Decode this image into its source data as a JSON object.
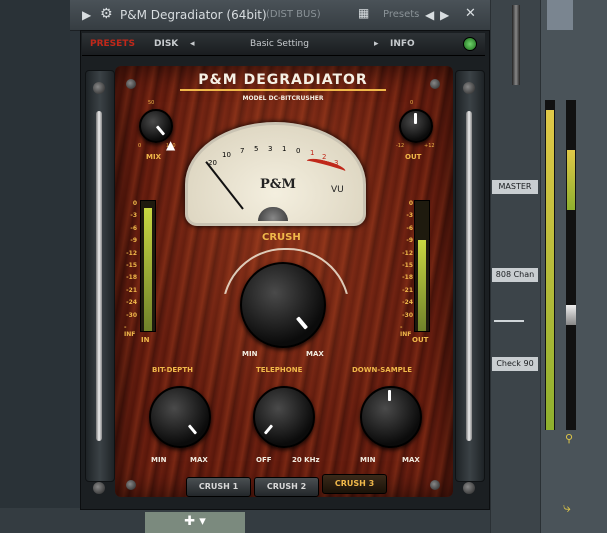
{
  "window": {
    "title": "P&M Degradiator (64bit)",
    "subtitle": "(DIST BUS)",
    "presets_menu": "Presets",
    "gear_icon": "gear-icon",
    "close_icon": "close-icon"
  },
  "plugin_header": {
    "preset_label": "DISK",
    "preset_name": "Basic Setting",
    "info_label": "INFO",
    "power_icon": "power-icon",
    "left_label": "PRESETS"
  },
  "panel": {
    "title": "P&M DEGRADIATOR",
    "model": "MODEL DC-BITCRUSHER",
    "mix_label": "MIX",
    "out_label": "OUT",
    "in_label": "IN",
    "out_meter_label": "OUT",
    "crush_label": "CRUSH",
    "crush_min": "MIN",
    "crush_max": "MAX",
    "vu_brand": "P&M",
    "vu_unit": "VU",
    "bit_depth_label": "BIT-DEPTH",
    "bit_min": "MIN",
    "bit_max": "MAX",
    "telephone_label": "TELEPHONE",
    "tel_off": "OFF",
    "tel_max": "20 KHz",
    "downsample_label": "DOWN-SAMPLE",
    "ds_min": "MIN",
    "ds_max": "MAX",
    "mix_scale_min": "0",
    "mix_scale_mid": "50",
    "mix_scale_max": "100",
    "out_scale_min": "-12",
    "out_scale_mid": "0",
    "out_scale_max": "+12"
  },
  "vu_scale": [
    "20",
    "10",
    "7",
    "5",
    "3",
    "1",
    "0",
    "1",
    "2",
    "3"
  ],
  "meter_ticks": [
    "0",
    "-3",
    "-6",
    "-9",
    "-12",
    "-15",
    "-18",
    "-21",
    "-24",
    "-30",
    "-INF"
  ],
  "presets": [
    {
      "label": "CRUSH 1",
      "active": false
    },
    {
      "label": "CRUSH 2",
      "active": false
    },
    {
      "label": "CRUSH 3",
      "active": true
    }
  ],
  "levels": {
    "in": 0.95,
    "out": 0.7
  },
  "mixer": {
    "label_1": "MASTER",
    "label_2": "808 Chan",
    "label_3": "Check 90"
  },
  "colors": {
    "accent": "#f0b84a",
    "wood": "#6b1f10",
    "meter_green": "#c8d842"
  }
}
